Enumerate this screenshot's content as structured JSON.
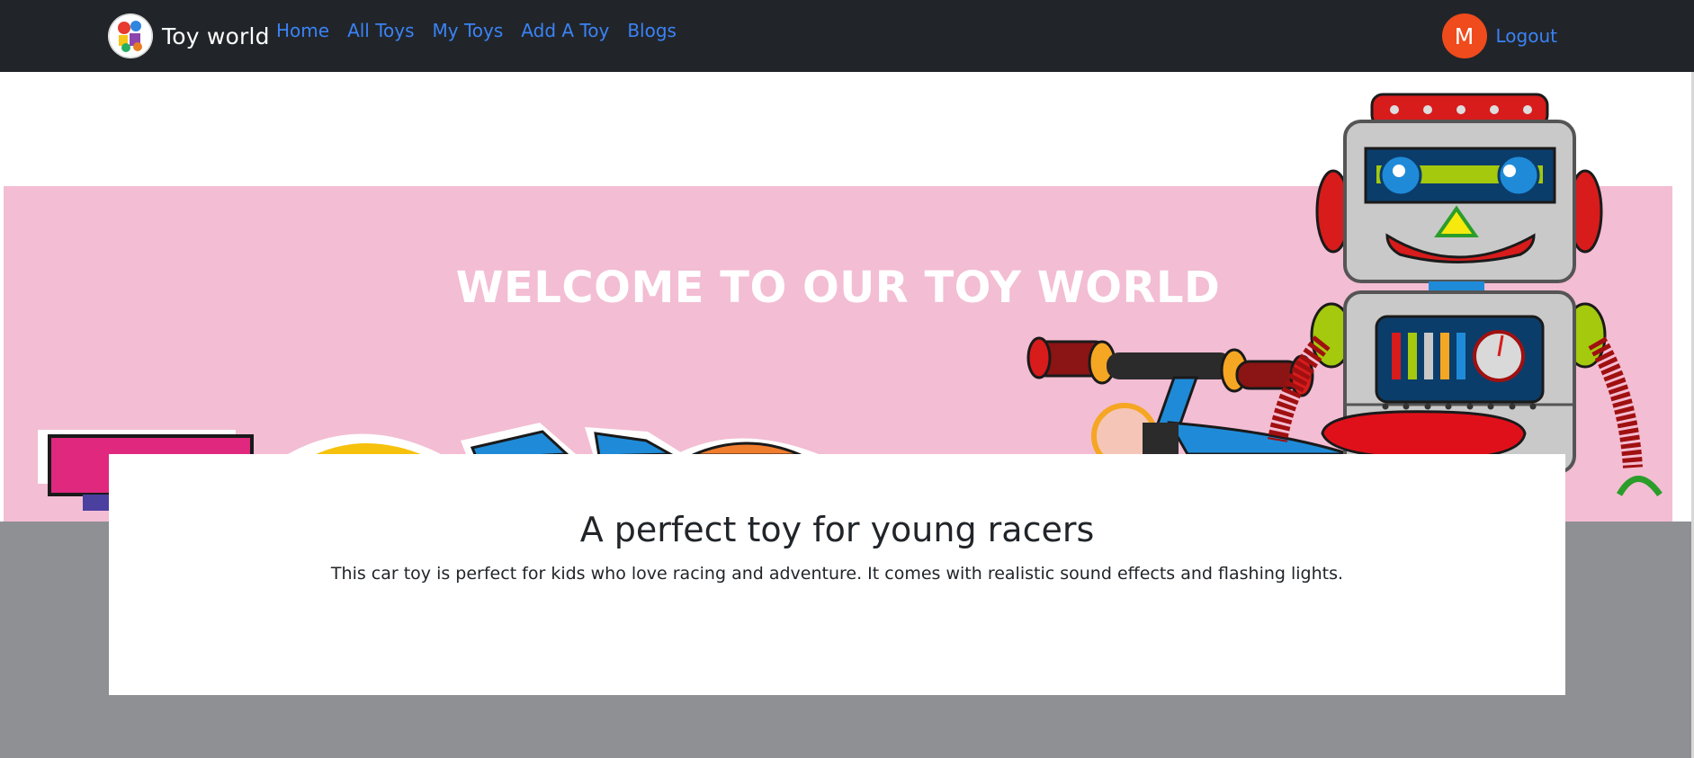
{
  "brand": {
    "name": "Toy world",
    "logo_icon": "toy-world-logo"
  },
  "nav": {
    "links": [
      {
        "label": "Home"
      },
      {
        "label": "All Toys"
      },
      {
        "label": "My Toys"
      },
      {
        "label": "Add A Toy"
      },
      {
        "label": "Blogs"
      }
    ],
    "avatar_initial": "M",
    "logout_label": "Logout"
  },
  "hero": {
    "title": "WELCOME TO OUR TOY WORLD",
    "images": [
      "robot-illustration",
      "tricycle-illustration",
      "toy-blocks-illustration"
    ]
  },
  "card": {
    "title": "A perfect toy for young racers",
    "description": "This car toy is perfect for kids who love racing and adventure. It comes with realistic sound effects and flashing lights."
  },
  "colors": {
    "navbar": "#212529",
    "link": "#3b82f6",
    "avatar": "#ef4b1c",
    "hero_pink": "#f3bdd3",
    "band_grey": "#8f9093"
  }
}
